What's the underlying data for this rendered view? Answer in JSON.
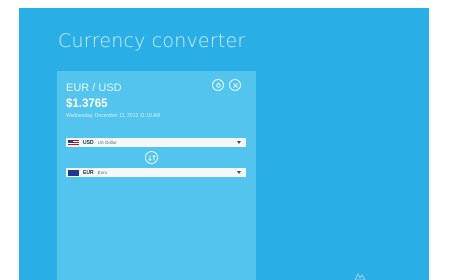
{
  "app": {
    "title": "Currency converter"
  },
  "panel": {
    "pair": "EUR / USD",
    "rate": "$1.3765",
    "updated": "Wednesday, December 11, 2013 11:18 AM"
  },
  "from_select": {
    "code": "USD",
    "name": "US Dollar",
    "flag_icon": "us-flag-icon"
  },
  "to_select": {
    "code": "EUR",
    "name": "Euro",
    "flag_icon": "eu-flag-icon"
  },
  "colors": {
    "background": "#29aee6",
    "panel": "#52c4ee"
  }
}
